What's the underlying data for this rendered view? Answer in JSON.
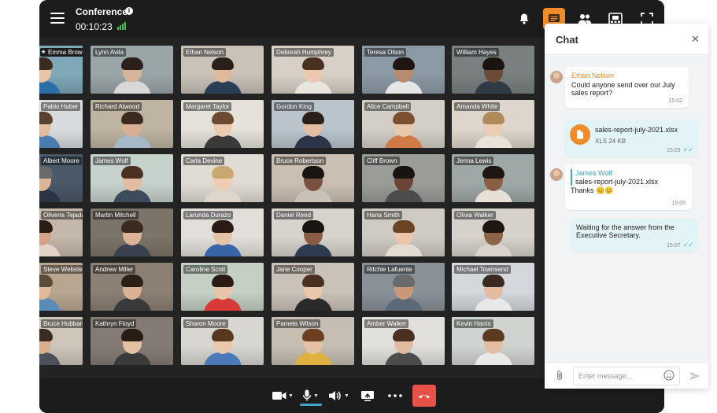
{
  "header": {
    "title": "Conference",
    "timer": "00:10:23"
  },
  "participants": [
    {
      "name": "Emma Brown",
      "bg": "#7fa8b8",
      "skin": "#e8c4a8",
      "hair": "#3a2a20",
      "shirt": "#2b6ea8"
    },
    {
      "name": "Lynn Avila",
      "bg": "#9aa5a8",
      "skin": "#d9b49c",
      "hair": "#2a1f1a",
      "shirt": "#d8d8d8"
    },
    {
      "name": "Ethan Nelson",
      "bg": "#c8c2b8",
      "skin": "#e0b89a",
      "hair": "#2a1f18",
      "shirt": "#2c3e55"
    },
    {
      "name": "Deborah Humphrey",
      "bg": "#d8d0c6",
      "skin": "#eac9b0",
      "hair": "#4a3020",
      "shirt": "#e8e4de"
    },
    {
      "name": "Teresa Olson",
      "bg": "#8c9aa6",
      "skin": "#b88a6e",
      "hair": "#1e1612",
      "shirt": "#e6e6e6"
    },
    {
      "name": "William Hayes",
      "bg": "#7a8080",
      "skin": "#6b4a38",
      "hair": "#1a1410",
      "shirt": "#2f3a45"
    },
    {
      "name": "Pablo Huber",
      "bg": "#d9dcde",
      "skin": "#e2bca0",
      "hair": "#5a4030",
      "shirt": "#4b7cb0"
    },
    {
      "name": "Richard Atwood",
      "bg": "#bfb4a2",
      "skin": "#d8b094",
      "hair": "#3a2a20",
      "shirt": "#a7b9c9"
    },
    {
      "name": "Margaret Taylor",
      "bg": "#e6e2da",
      "skin": "#eccab0",
      "hair": "#6a4a30",
      "shirt": "#3a3a3a"
    },
    {
      "name": "Gordon King",
      "bg": "#b9c4cc",
      "skin": "#e4bea2",
      "hair": "#2a2018",
      "shirt": "#2c3448"
    },
    {
      "name": "Alice Campbell",
      "bg": "#d4cfc6",
      "skin": "#eac8ac",
      "hair": "#7a5030",
      "shirt": "#d07a48"
    },
    {
      "name": "Amanda White",
      "bg": "#ddd6cc",
      "skin": "#ecccb2",
      "hair": "#b08a5a",
      "shirt": "#e8e2d8"
    },
    {
      "name": "Albert Moore",
      "bg": "#4a5868",
      "skin": "#dcb49a",
      "hair": "#6a6a6a",
      "shirt": "#2a3444"
    },
    {
      "name": "James Wolf",
      "bg": "#c6d2cc",
      "skin": "#e2bca0",
      "hair": "#4a3020",
      "shirt": "#3d4c5c"
    },
    {
      "name": "Carla Devine",
      "bg": "#e0dcd4",
      "skin": "#eecdb4",
      "hair": "#c8a870",
      "shirt": "#ddd6ca"
    },
    {
      "name": "Bruce Robertson",
      "bg": "#cabfb2",
      "skin": "#7a5040",
      "hair": "#1a1410",
      "shirt": "#c8c2b8"
    },
    {
      "name": "Cliff Brown",
      "bg": "#9a9c98",
      "skin": "#6a4434",
      "hair": "#1a1410",
      "shirt": "#4c4c4c"
    },
    {
      "name": "Jenna Lewis",
      "bg": "#9ea8a6",
      "skin": "#8a5e44",
      "hair": "#1e1612",
      "shirt": "#e6e0d6"
    },
    {
      "name": "Oliveria Tejada",
      "bg": "#c4b8aa",
      "skin": "#d2a486",
      "hair": "#2a1c14",
      "shirt": "#e0d4c6"
    },
    {
      "name": "Martin Mitchell",
      "bg": "#7c7468",
      "skin": "#dcb498",
      "hair": "#3a2a20",
      "shirt": "#3a4250"
    },
    {
      "name": "Larunda Durazo",
      "bg": "#e2dfda",
      "skin": "#e4c2a6",
      "hair": "#2a1c14",
      "shirt": "#3a64a8"
    },
    {
      "name": "Daniel Reed",
      "bg": "#d6d2cc",
      "skin": "#8a5c44",
      "hair": "#1a1410",
      "shirt": "#2c3a52"
    },
    {
      "name": "Hana Smith",
      "bg": "#cfcac2",
      "skin": "#ebc6aa",
      "hair": "#6a4424",
      "shirt": "#e2dcd2"
    },
    {
      "name": "Olivia Walker",
      "bg": "#d6d2ca",
      "skin": "#8e6448",
      "hair": "#1e1612",
      "shirt": "#d8d4cc"
    },
    {
      "name": "Steve Webster",
      "bg": "#b8a690",
      "skin": "#e0b89a",
      "hair": "#5a4a3a",
      "shirt": "#5a8ab8"
    },
    {
      "name": "Andrew Miller",
      "bg": "#8c8074",
      "skin": "#dab294",
      "hair": "#2a2018",
      "shirt": "#3a3a3a"
    },
    {
      "name": "Caroline Scott",
      "bg": "#c4d0c4",
      "skin": "#e8c4a8",
      "hair": "#2a1c14",
      "shirt": "#d83a3a"
    },
    {
      "name": "Jane Cooper",
      "bg": "#cac2b8",
      "skin": "#eac8ae",
      "hair": "#4a3020",
      "shirt": "#2a2a2a"
    },
    {
      "name": "Ritchie Lafuente",
      "bg": "#8a9098",
      "skin": "#c89878",
      "hair": "#6a6a6a",
      "shirt": "#5a6878"
    },
    {
      "name": "Michael Townsend",
      "bg": "#d4d8dc",
      "skin": "#e2bca0",
      "hair": "#3a2a20",
      "shirt": "#e8e8e8"
    },
    {
      "name": "Bruce Hubbard",
      "bg": "#cfc6ba",
      "skin": "#d8ae90",
      "hair": "#3a2a20",
      "shirt": "#4c5058"
    },
    {
      "name": "Kathryn Floyd",
      "bg": "#847c74",
      "skin": "#e4c0a4",
      "hair": "#2a1c14",
      "shirt": "#3a3a3a"
    },
    {
      "name": "Sharon Moore",
      "bg": "#d8d6d0",
      "skin": "#eac8ac",
      "hair": "#5a3820",
      "shirt": "#4a7ab8"
    },
    {
      "name": "Pamela Wilson",
      "bg": "#c6beb2",
      "skin": "#e6c2a4",
      "hair": "#6a4020",
      "shirt": "#e0b040"
    },
    {
      "name": "Amber Walker",
      "bg": "#e2e0dc",
      "skin": "#e2bca0",
      "hair": "#4a3020",
      "shirt": "#4c4c4c"
    },
    {
      "name": "Kevin Harris",
      "bg": "#d0d4d0",
      "skin": "#e4bea2",
      "hair": "#5a3a20",
      "shirt": "#e8e8e8"
    }
  ],
  "chat": {
    "title": "Chat",
    "messages": [
      {
        "sender": "Ethan Nelson",
        "text": "Could anyone send over our July sales report?",
        "time": "15:02"
      },
      {
        "file_name": "sales-report-july-2021.xlsx",
        "file_meta": "XLS 24 KB",
        "time": "15:03"
      },
      {
        "sender": "James Wolf",
        "quote": "sales-report-july-2021.xlsx",
        "text": "Thanks 😊😊",
        "time": "15:05"
      },
      {
        "text": "Waiting for the answer from the Executive Secretary.",
        "time": "15:07"
      }
    ],
    "input_placeholder": "Enter message..."
  },
  "colors": {
    "accent": "#f28c28",
    "hangup": "#e8504a",
    "signal": "#3fc24a",
    "link": "#3fa6c9"
  }
}
